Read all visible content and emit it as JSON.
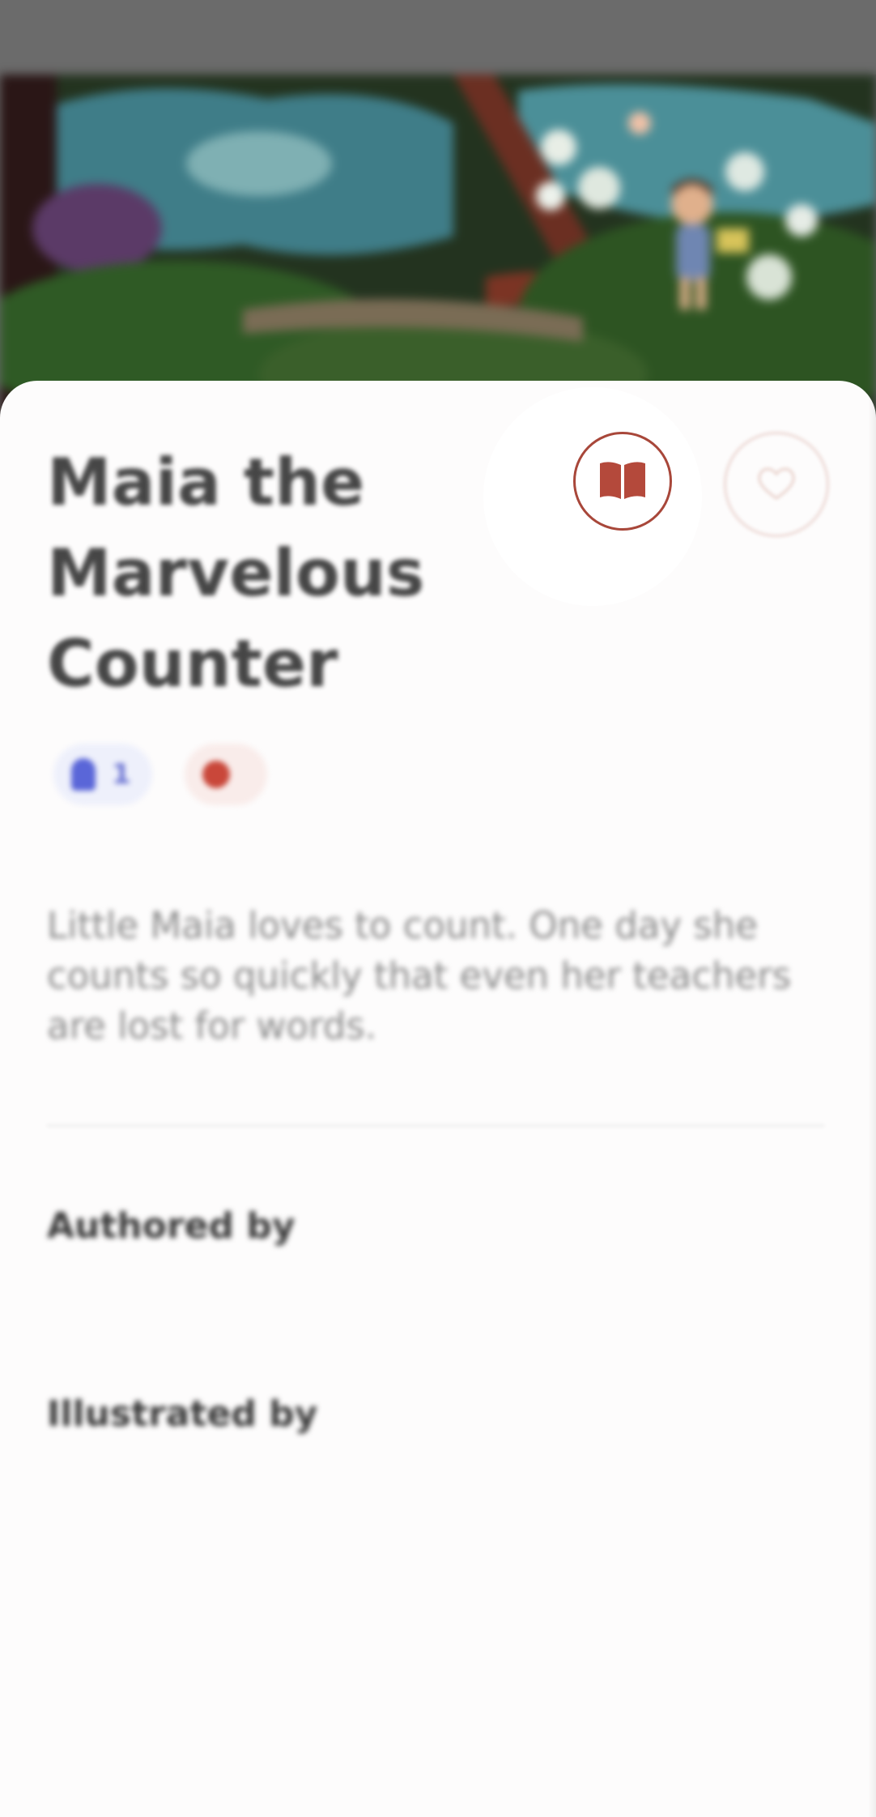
{
  "book": {
    "title": "Maia the Marvelous Counter",
    "cover_alt": "Illustration of a girl in a forest with trees and flowers",
    "level": "1",
    "words": "",
    "description": "Little Maia loves to count. One day she counts so quickly that even her teachers are lost for words."
  },
  "icons": {
    "read": "open-book-icon",
    "favorite": "heart-icon",
    "level": "level-icon",
    "words": "words-icon"
  },
  "credits": {
    "author_label": "Authored by",
    "author_name": "",
    "illustrator_label": "Illustrated by",
    "illustrator_name": ""
  },
  "colors": {
    "accent": "#a8473a",
    "level_chip_bg": "#eef0fb",
    "level_chip_fg": "#5a66d8",
    "words_chip_bg": "#f9ecea",
    "link": "#c9766a",
    "sheet_bg": "#fdfcfc"
  }
}
